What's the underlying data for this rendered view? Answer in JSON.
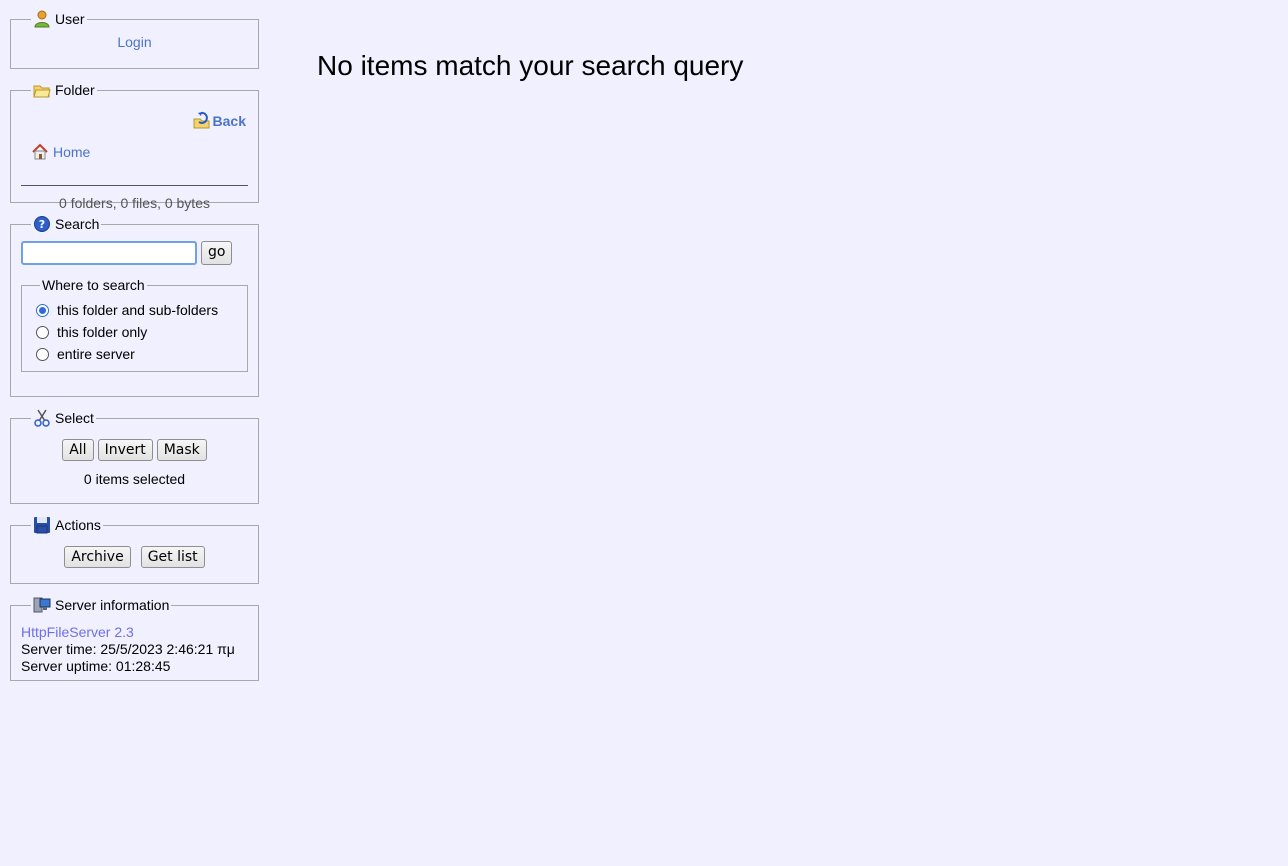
{
  "user": {
    "title": "User",
    "login": "Login"
  },
  "folder": {
    "title": "Folder",
    "back": "Back",
    "home": "Home",
    "stats": "0 folders, 0 files, 0 bytes"
  },
  "search": {
    "title": "Search",
    "input_value": "",
    "go": "go",
    "where_title": "Where to search",
    "options": [
      "this folder and sub-folders",
      "this folder only",
      "entire server"
    ],
    "selected": "this folder and sub-folders"
  },
  "select": {
    "title": "Select",
    "all": "All",
    "invert": "Invert",
    "mask": "Mask",
    "status": "0 items selected"
  },
  "actions": {
    "title": "Actions",
    "archive": "Archive",
    "getlist": "Get list"
  },
  "server": {
    "title": "Server information",
    "link": "HttpFileServer 2.3",
    "time": "Server time: 25/5/2023 2:46:21 πμ",
    "uptime": "Server uptime: 01:28:45"
  },
  "main": {
    "message": "No items match your search query"
  },
  "icons": {
    "user": "user-icon",
    "folder": "open-folder-icon",
    "back": "back-folder-icon",
    "home": "home-icon",
    "search": "question-icon",
    "select": "scissors-icon",
    "actions": "floppy-disk-icon",
    "server": "computer-icon"
  },
  "colors": {
    "background": "#f0f0fe",
    "link": "#4a74cc",
    "server_link": "#6f6fe8",
    "border": "#a8a8a8"
  }
}
